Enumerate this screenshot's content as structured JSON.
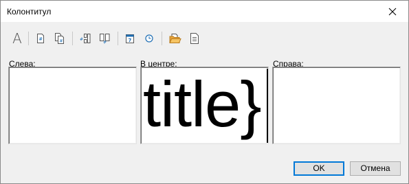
{
  "window": {
    "title": "Колонтитул"
  },
  "toolbar": {
    "buttons": [
      {
        "name": "font-icon",
        "glyph": "A"
      },
      {
        "name": "page-number-icon"
      },
      {
        "name": "page-count-icon"
      },
      {
        "name": "insert-split-icon"
      },
      {
        "name": "insert-pair-icon"
      },
      {
        "name": "calendar-icon"
      },
      {
        "name": "clock-icon"
      },
      {
        "name": "folder-icon"
      },
      {
        "name": "document-icon"
      }
    ]
  },
  "sections": {
    "left": {
      "label": "Слева:",
      "value": ""
    },
    "center": {
      "label": "В центре:",
      "value": "title}"
    },
    "right": {
      "label": "Справа:",
      "value": ""
    }
  },
  "footer": {
    "ok_label": "OK",
    "cancel_label": "Отмена"
  },
  "colors": {
    "accent": "#0078d7",
    "folder": "#f0a030",
    "icon": "#1e6eb4"
  }
}
